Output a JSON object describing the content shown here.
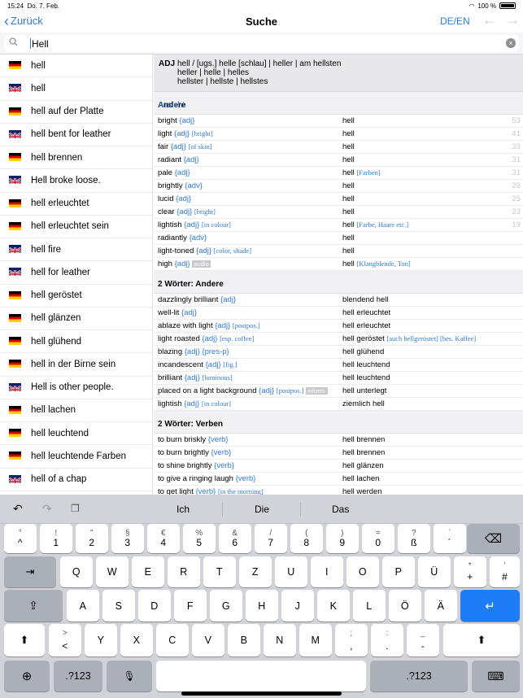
{
  "status": {
    "time": "15:24",
    "date": "Do. 7. Feb.",
    "battery": "100 %"
  },
  "nav": {
    "back": "Zurück",
    "title": "Suche",
    "lang": "DE/EN"
  },
  "search": {
    "value": "Hell"
  },
  "left_list": [
    {
      "flag": "de",
      "label": "hell"
    },
    {
      "flag": "uk",
      "label": "hell"
    },
    {
      "flag": "de",
      "label": "hell auf der Platte"
    },
    {
      "flag": "uk",
      "label": "hell bent for leather"
    },
    {
      "flag": "de",
      "label": "hell brennen"
    },
    {
      "flag": "uk",
      "label": "Hell broke loose."
    },
    {
      "flag": "de",
      "label": "hell erleuchtet"
    },
    {
      "flag": "de",
      "label": "hell erleuchtet sein"
    },
    {
      "flag": "uk",
      "label": "hell fire"
    },
    {
      "flag": "uk",
      "label": "hell for leather"
    },
    {
      "flag": "de",
      "label": "hell geröstet"
    },
    {
      "flag": "de",
      "label": "hell glänzen"
    },
    {
      "flag": "de",
      "label": "hell glühend"
    },
    {
      "flag": "de",
      "label": "hell in der Birne sein"
    },
    {
      "flag": "uk",
      "label": "Hell is other people."
    },
    {
      "flag": "de",
      "label": "hell lachen"
    },
    {
      "flag": "de",
      "label": "hell leuchtend"
    },
    {
      "flag": "de",
      "label": "hell leuchtende Farben"
    },
    {
      "flag": "uk",
      "label": "hell of a chap"
    }
  ],
  "adj": {
    "tag": "ADJ",
    "line1": "hell / [ugs.] helle [schlau] | heller | am hellsten",
    "line2": "heller | helle | helles",
    "line3": "hellster | hellste | hellstes"
  },
  "sections": [
    {
      "title": "Andere",
      "action": "Ansicht",
      "rows": [
        {
          "en": "bright",
          "tag": "{adj}",
          "en_note": "",
          "de": "hell",
          "de_note": "",
          "num": "53"
        },
        {
          "en": "light",
          "tag": "{adj}",
          "en_note": "[bright]",
          "de": "hell",
          "de_note": "",
          "num": "41"
        },
        {
          "en": "fair",
          "tag": "{adj}",
          "en_note": "[of skin]",
          "de": "hell",
          "de_note": "",
          "num": "33"
        },
        {
          "en": "radiant",
          "tag": "{adj}",
          "en_note": "",
          "de": "hell",
          "de_note": "",
          "num": "31"
        },
        {
          "en": "pale",
          "tag": "{adj}",
          "en_note": "",
          "de": "hell",
          "de_note": "[Farben]",
          "num": "31"
        },
        {
          "en": "brightly",
          "tag": "{adv}",
          "en_note": "",
          "de": "hell",
          "de_note": "",
          "num": "26"
        },
        {
          "en": "lucid",
          "tag": "{adj}",
          "en_note": "",
          "de": "hell",
          "de_note": "",
          "num": "25"
        },
        {
          "en": "clear",
          "tag": "{adj}",
          "en_note": "[bright]",
          "de": "hell",
          "de_note": "",
          "num": "23"
        },
        {
          "en": "lightish",
          "tag": "{adj}",
          "en_note": "[in colour]",
          "de": "hell",
          "de_note": "[Farbe, Haare etc.]",
          "num": "19"
        },
        {
          "en": "radiantly",
          "tag": "{adv}",
          "en_note": "",
          "de": "hell",
          "de_note": "",
          "num": ""
        },
        {
          "en": "light-toned",
          "tag": "{adj}",
          "en_note": "[color, shade]",
          "de": "hell",
          "de_note": "",
          "num": ""
        },
        {
          "en": "high",
          "tag": "{adj}",
          "en_note": "",
          "en_badge": "audio",
          "de": "hell",
          "de_note": "[Klangblende, Ton]",
          "num": ""
        }
      ]
    },
    {
      "title": "2 Wörter: Andere",
      "action": "",
      "rows": [
        {
          "en": "dazzlingly brilliant",
          "tag": "{adj}",
          "en_note": "",
          "de": "blendend hell",
          "de_note": "",
          "num": ""
        },
        {
          "en": "well-lit",
          "tag": "{adj}",
          "en_note": "",
          "de": "hell erleuchtet",
          "de_note": "",
          "num": ""
        },
        {
          "en": "ablaze with light",
          "tag": "{adj}",
          "en_note": "[postpos.]",
          "de": "hell erleuchtet",
          "de_note": "",
          "num": ""
        },
        {
          "en": "light roasted",
          "tag": "{adj}",
          "en_note": "[esp. coffee]",
          "de": "hell geröstet",
          "de_note": "[auch hellgeröstet] [bes. Kaffee]",
          "num": ""
        },
        {
          "en": "blazing",
          "tag": "{adj} {pres-p}",
          "en_note": "",
          "de": "hell glühend",
          "de_note": "",
          "num": ""
        },
        {
          "en": "incandescent",
          "tag": "{adj}",
          "en_note": "[fig.]",
          "de": "hell leuchtend",
          "de_note": "",
          "num": ""
        },
        {
          "en": "brilliant",
          "tag": "{adj}",
          "en_note": "[luminous]",
          "de": "hell leuchtend",
          "de_note": "",
          "num": ""
        },
        {
          "en": "placed on a light background",
          "tag": "{adj}",
          "en_note": "[postpos.]",
          "en_badge": "inform.",
          "de": "hell unterlegt",
          "de_note": "",
          "num": ""
        },
        {
          "en": "lightish",
          "tag": "{adj}",
          "en_note": "[in colour]",
          "de": "ziemlich hell",
          "de_note": "",
          "num": ""
        }
      ]
    },
    {
      "title": "2 Wörter: Verben",
      "action": "",
      "rows": [
        {
          "en": "to burn briskly",
          "tag": "{verb}",
          "en_note": "",
          "de": "hell brennen",
          "de_note": "",
          "num": ""
        },
        {
          "en": "to burn brightly",
          "tag": "{verb}",
          "en_note": "",
          "de": "hell brennen",
          "de_note": "",
          "num": ""
        },
        {
          "en": "to shine brightly",
          "tag": "{verb}",
          "en_note": "",
          "de": "hell glänzen",
          "de_note": "",
          "num": ""
        },
        {
          "en": "to give a ringing laugh",
          "tag": "{verb}",
          "en_note": "",
          "de": "hell lachen",
          "de_note": "",
          "num": ""
        },
        {
          "en": "to get light",
          "tag": "{verb}",
          "en_note": "[in the morning]",
          "de": "hell werden",
          "de_note": "",
          "num": ""
        }
      ]
    }
  ],
  "keyboard": {
    "suggestions": [
      "Ich",
      "Die",
      "Das"
    ],
    "row1": [
      [
        "°",
        "^"
      ],
      [
        "!",
        "1"
      ],
      [
        "\"",
        "2"
      ],
      [
        "§",
        "3"
      ],
      [
        "€",
        "4"
      ],
      [
        "%",
        "5"
      ],
      [
        "&",
        "6"
      ],
      [
        "/",
        "7"
      ],
      [
        "(",
        "8"
      ],
      [
        ")",
        "9"
      ],
      [
        "=",
        "0"
      ],
      [
        "?",
        "ß"
      ],
      [
        "`",
        "´"
      ]
    ],
    "row2": [
      "Q",
      "W",
      "E",
      "R",
      "T",
      "Z",
      "U",
      "I",
      "O",
      "P",
      "Ü"
    ],
    "row2_last": [
      "*",
      "+"
    ],
    "row2_hash": [
      "'",
      "#"
    ],
    "row3": [
      "A",
      "S",
      "D",
      "F",
      "G",
      "H",
      "J",
      "K",
      "L",
      "Ö",
      "Ä"
    ],
    "row4_first": [
      ">",
      "<"
    ],
    "row4": [
      "Y",
      "X",
      "C",
      "V",
      "B",
      "N",
      "M"
    ],
    "row4_punct": [
      [
        ";",
        ","
      ],
      [
        ":",
        "."
      ],
      [
        "_",
        "-"
      ]
    ],
    "numkey": ".?123"
  }
}
